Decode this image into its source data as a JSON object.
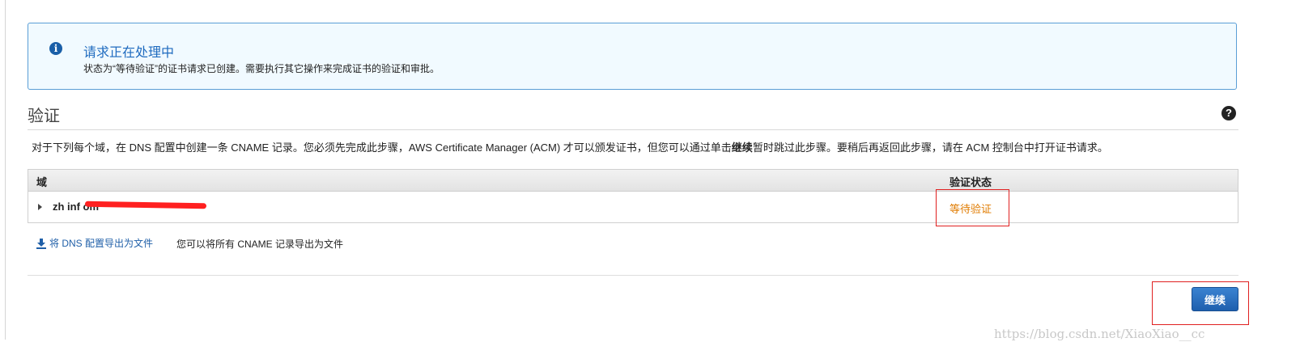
{
  "info": {
    "title": "请求正在处理中",
    "message": "状态为“等待验证”的证书请求已创建。需要执行其它操作来完成证书的验证和审批。",
    "icon": "info-icon"
  },
  "section": {
    "title": "验证",
    "help_icon": "help-icon",
    "description_before": "对于下列每个域，在 DNS 配置中创建一条 CNAME 记录。您必须先完成此步骤，AWS Certificate Manager (ACM) 才可以颁发证书，但您可以通过单击",
    "description_bold": "继续",
    "description_after": "暂时跳过此步骤。要稍后再返回此步骤，请在 ACM 控制台中打开证书请求。"
  },
  "table": {
    "headers": {
      "domain": "域",
      "status": "验证状态"
    },
    "rows": [
      {
        "domain": "zh                              inf    om",
        "status": "等待验证"
      }
    ]
  },
  "export": {
    "link_label": "将 DNS 配置导出为文件",
    "hint": "您可以将所有 CNAME 记录导出为文件"
  },
  "actions": {
    "continue_label": "继续"
  },
  "watermark": "https://blog.csdn.net/XiaoXiao__cc",
  "colors": {
    "accent_blue": "#1f6bbf",
    "status_orange": "#e07b00",
    "annotation_red": "#e02020",
    "info_background": "#f1faff"
  }
}
